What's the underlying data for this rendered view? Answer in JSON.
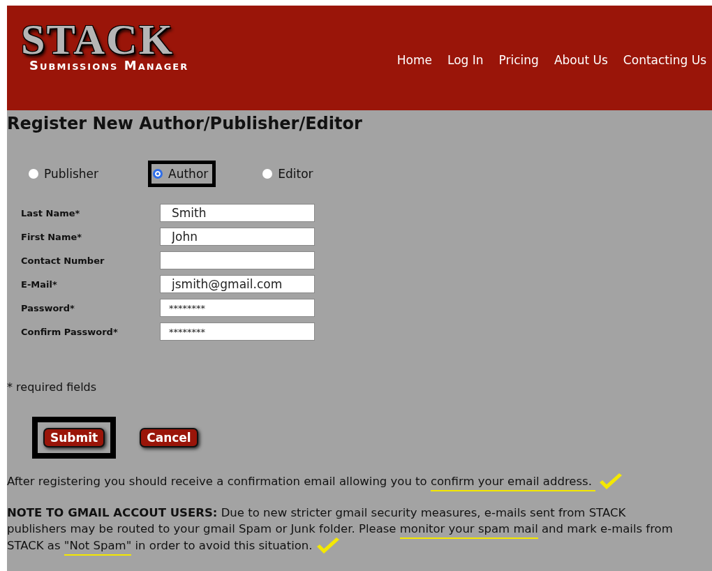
{
  "header": {
    "logo": {
      "title": "STACK",
      "subtitle": "Submissions Manager"
    },
    "nav": [
      {
        "label": "Home"
      },
      {
        "label": "Log In"
      },
      {
        "label": "Pricing"
      },
      {
        "label": "About Us"
      },
      {
        "label": "Contacting Us"
      }
    ]
  },
  "page_title": "Register New Author/Publisher/Editor",
  "roles": [
    {
      "label": "Publisher",
      "selected": false,
      "highlighted": false
    },
    {
      "label": "Author",
      "selected": true,
      "highlighted": true
    },
    {
      "label": "Editor",
      "selected": false,
      "highlighted": false
    }
  ],
  "fields": [
    {
      "label": "Last Name*",
      "value": "Smith",
      "kind": "text"
    },
    {
      "label": "First Name*",
      "value": "John",
      "kind": "text"
    },
    {
      "label": "Contact Number",
      "kind": "text"
    },
    {
      "label": "E-Mail*",
      "value": "jsmith@gmail.com",
      "kind": "text"
    },
    {
      "label": "Password*",
      "value": "********",
      "kind": "password"
    },
    {
      "label": "Confirm Password*",
      "value": "********",
      "kind": "password"
    }
  ],
  "required_note": "* required fields",
  "buttons": [
    {
      "label": "Submit",
      "highlighted": true
    },
    {
      "label": "Cancel",
      "highlighted": false
    }
  ],
  "paragraphs": [
    {
      "check_mark": true,
      "segments": [
        {
          "text": "After registering you should receive a confirmation email allowing you to ",
          "underlined": false
        },
        {
          "text": "confirm your email address. ",
          "underlined": true
        }
      ]
    },
    {
      "check_mark": true,
      "segments": [
        {
          "text": "**NOTE TO GMAIL ACCOUT USERS:** Due to new stricter gmail security measures, e-mails sent from STACK publishers may be routed to your gmail Spam or Junk folder. Please ",
          "underlined": false
        },
        {
          "text": "monitor your spam mail",
          "underlined": true
        },
        {
          "text": " and mark e-mails from STACK as ",
          "underlined": false
        },
        {
          "text": "\"Not Spam\"",
          "underlined": true
        },
        {
          "text": " in order to avoid this situation.",
          "underlined": false
        }
      ]
    }
  ]
}
